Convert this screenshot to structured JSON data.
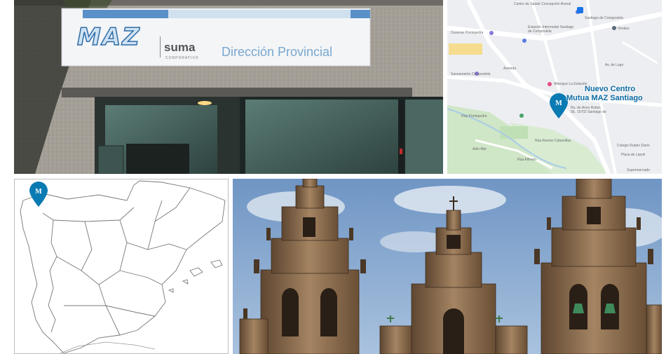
{
  "storefront": {
    "brand": "MAZ",
    "partner": "suma",
    "partner_sub": "CORPORATIVO",
    "sign_text": "Dirección Provincial"
  },
  "map": {
    "title_line1": "Nuevo Centro",
    "title_line2": "Mutua MAZ Santiago",
    "address_line1": "Ra. de Anxo Rubal,",
    "address_line2": "5E, 15702 Santiago de",
    "labels": [
      "Centro de Saúde Concepción Arenal",
      "Santiago de Compostela",
      "Estación Intermodal Santiago de Compostela",
      "Vendus",
      "Ourense Pontepedra",
      "Saneamento Compostela",
      "Albergue La Estación",
      "Avenida",
      "Av. de Lugo",
      "Rúa Pontepedra",
      "Rúa Ramón Cabanillas",
      "Colegio Rubén Darío",
      "Plaza de Lepoli",
      "Supermercado",
      "Rúa Alfonso",
      "Alén Mar"
    ],
    "accent": "#0a7ab3"
  },
  "spain_map": {
    "marker_letter": "M",
    "marker_color": "#0a7ab3"
  },
  "cathedral": {
    "sky_color": "#7fa2cc",
    "stone_color": "#8a6a4a"
  }
}
